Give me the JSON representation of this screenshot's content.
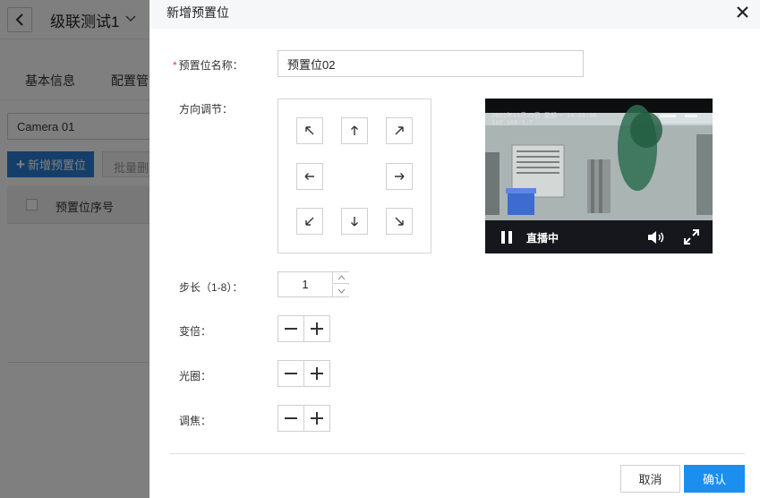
{
  "background": {
    "title": "级联测试1",
    "tabs": [
      "基本信息",
      "配置管"
    ],
    "camera_select": "Camera 01",
    "add_button": "新增预置位",
    "batch_button": "批量删除",
    "table_header": "预置位序号"
  },
  "modal": {
    "title": "新增预置位",
    "name_label": "预置位名称：",
    "name_value": "预置位02",
    "direction_label": "方向调节：",
    "step_label": "步长（1-8）：",
    "step_value": "1",
    "zoom_label": "变倍：",
    "iris_label": "光圈：",
    "focus_label": "调焦：",
    "video": {
      "osd_line1": "2021年11月25日 星期一 14:23:36",
      "osd_line2": "192.168.1.7",
      "live_label": "直播中"
    },
    "cancel_label": "取消",
    "confirm_label": "确认"
  },
  "colors": {
    "primary": "#1a8ff0",
    "background_primary": "#2b7fd3",
    "required": "#e0433d"
  }
}
